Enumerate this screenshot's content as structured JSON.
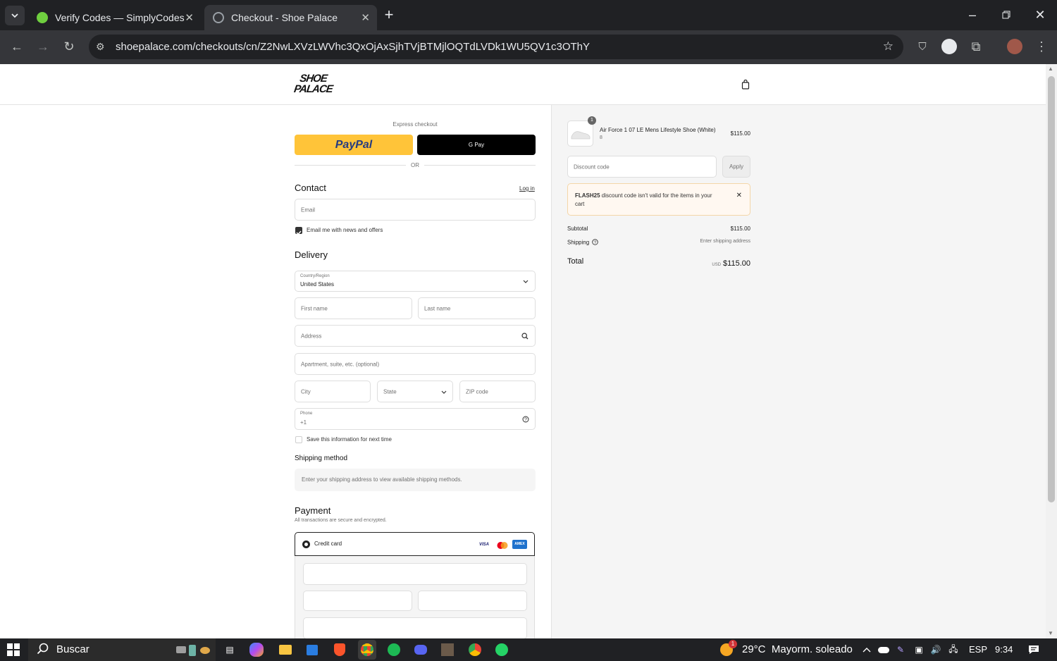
{
  "browser": {
    "tabs": [
      {
        "title": "Verify Codes — SimplyCodes",
        "active": false
      },
      {
        "title": "Checkout - Shoe Palace",
        "active": true
      }
    ],
    "url": "shoepalace.com/checkouts/cn/Z2NwLXVzLWVhc3QxOjAxSjhTVjBTMjlOQTdLVDk1WU5QV1c3OThY"
  },
  "store": {
    "logo_line1": "SHOE",
    "logo_line2": "PALACE"
  },
  "express": {
    "label": "Express checkout",
    "paypal_label": "PayPal",
    "gpay_label": "G Pay",
    "or_label": "OR"
  },
  "contact": {
    "heading": "Contact",
    "login_link": "Log in",
    "email_placeholder": "Email",
    "newsletter_label": "Email me with news and offers",
    "newsletter_checked": true
  },
  "delivery": {
    "heading": "Delivery",
    "country_label": "Country/Region",
    "country_value": "United States",
    "first_name_placeholder": "First name",
    "last_name_placeholder": "Last name",
    "address_placeholder": "Address",
    "apartment_placeholder": "Apartment, suite, etc. (optional)",
    "city_placeholder": "City",
    "state_placeholder": "State",
    "zip_placeholder": "ZIP code",
    "phone_label": "Phone",
    "phone_value": "+1",
    "save_info_label": "Save this information for next time"
  },
  "shipping": {
    "heading": "Shipping method",
    "notice": "Enter your shipping address to view available shipping methods."
  },
  "payment": {
    "heading": "Payment",
    "subtitle": "All transactions are secure and encrypted.",
    "method_label": "Credit card",
    "card_brands": [
      "VISA",
      "Mastercard",
      "AMEX"
    ]
  },
  "summary": {
    "item": {
      "name": "Air Force 1 07 LE Mens Lifestyle Shoe (White)",
      "variant": "8",
      "quantity": "1",
      "price": "$115.00"
    },
    "discount_placeholder": "Discount code",
    "apply_label": "Apply",
    "error_code": "FLASH25",
    "error_text": " discount code isn't valid for the items in your cart",
    "subtotal_label": "Subtotal",
    "subtotal_value": "$115.00",
    "shipping_label": "Shipping",
    "shipping_value": "Enter shipping address",
    "total_label": "Total",
    "total_currency": "USD",
    "total_value": "$115.00"
  },
  "taskbar": {
    "search_label": "Buscar",
    "weather": "29°C  Mayorm. soleado",
    "language": "ESP",
    "time": "9:34",
    "weather_badge": "1"
  },
  "colors": {
    "paypal_yellow": "#ffc439",
    "gpay_black": "#000000",
    "error_bg": "#fff8f1",
    "error_border": "#f4d6a8"
  }
}
